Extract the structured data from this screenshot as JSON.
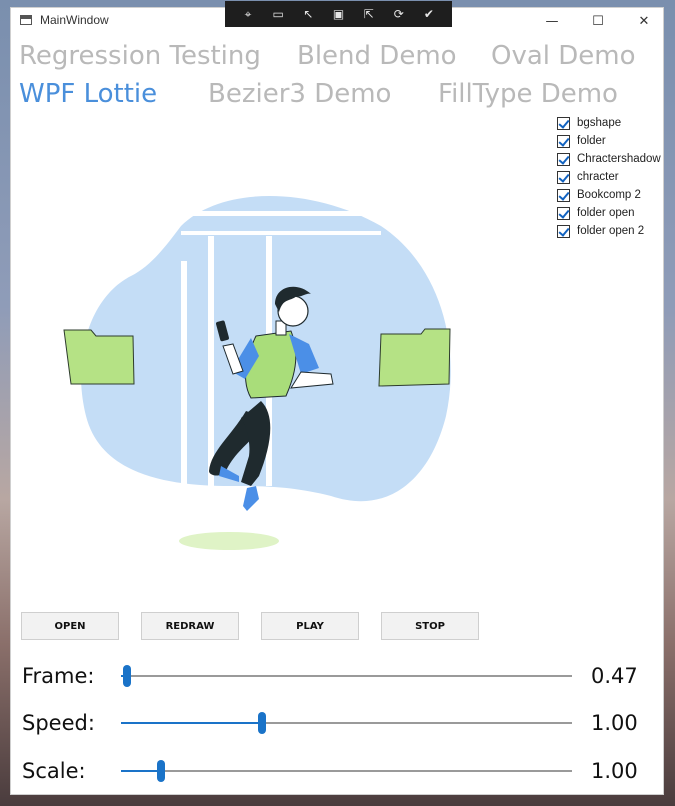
{
  "window": {
    "title": "MainWindow"
  },
  "title_controls": {
    "minimize": "—",
    "maximize": "☐",
    "close": "✕"
  },
  "debug_toolbar": {
    "icons": [
      "select-element-icon",
      "video-icon",
      "pointer-icon",
      "frame-icon",
      "inspect-icon",
      "hot-reload-icon",
      "check-circle-icon"
    ]
  },
  "tabs": {
    "row1": [
      {
        "label": "Regression Testing"
      },
      {
        "label": "Blend Demo"
      },
      {
        "label": "Oval Demo"
      }
    ],
    "row2": [
      {
        "label": "WPF Lottie",
        "active": true
      },
      {
        "label": "Bezier3 Demo"
      },
      {
        "label": "FillType Demo"
      }
    ]
  },
  "layers": [
    {
      "label": "bgshape",
      "checked": true
    },
    {
      "label": "folder",
      "checked": true
    },
    {
      "label": "Chractershadow",
      "checked": true
    },
    {
      "label": "chracter",
      "checked": true
    },
    {
      "label": "Bookcomp 2",
      "checked": true
    },
    {
      "label": "folder open",
      "checked": true
    },
    {
      "label": "folder open 2",
      "checked": true
    }
  ],
  "buttons": {
    "open": "OPEN",
    "redraw": "REDRAW",
    "play": "PLAY",
    "stop": "STOP"
  },
  "sliders": {
    "frame": {
      "label": "Frame:",
      "value": "0.47",
      "fraction": 0.013
    },
    "speed": {
      "label": "Speed:",
      "value": "1.00",
      "fraction": 0.313
    },
    "scale": {
      "label": "Scale:",
      "value": "1.00",
      "fraction": 0.089
    }
  },
  "colors": {
    "accent": "#1a73c8",
    "active_tab": "#4a8fdb",
    "inactive_tab": "#b9b9b9",
    "bg_shape": "#c4ddf6",
    "folder": "#b5e285",
    "shirt": "#4b8fe7",
    "vest": "#a9dd7a",
    "pants": "#1f2a2e"
  }
}
